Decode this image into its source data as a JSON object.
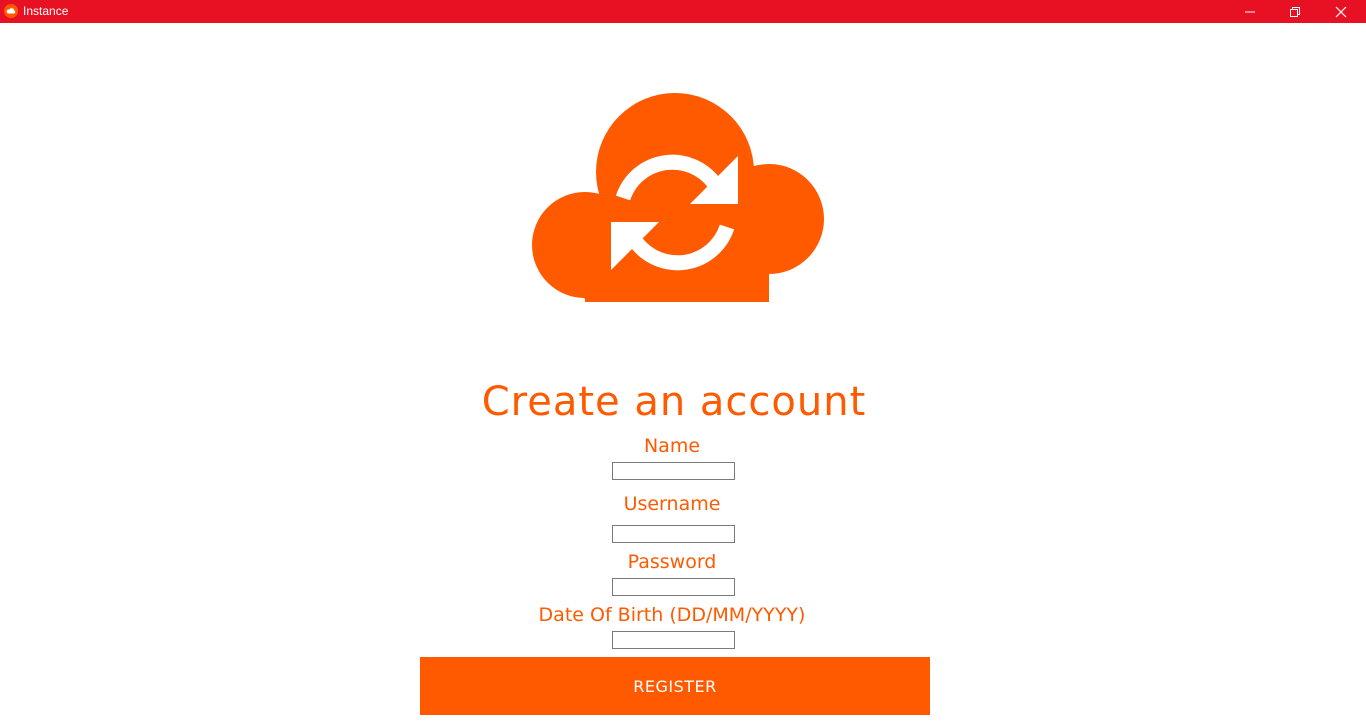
{
  "window": {
    "title": "Instance",
    "titlebar_color": "#e81123",
    "controls": [
      "minimize-icon",
      "restore-icon",
      "close-icon"
    ]
  },
  "brand": {
    "logo": "cloud-sync-icon",
    "accent_color": "#ff5a00"
  },
  "form": {
    "heading": "Create an account",
    "fields": [
      {
        "label": "Name",
        "value": "",
        "placeholder": ""
      },
      {
        "label": "Username",
        "value": "",
        "placeholder": ""
      },
      {
        "label": "Password",
        "value": "",
        "placeholder": ""
      },
      {
        "label": "Date Of Birth (DD/MM/YYYY)",
        "value": "",
        "placeholder": ""
      }
    ],
    "submit_label": "REGISTER"
  }
}
